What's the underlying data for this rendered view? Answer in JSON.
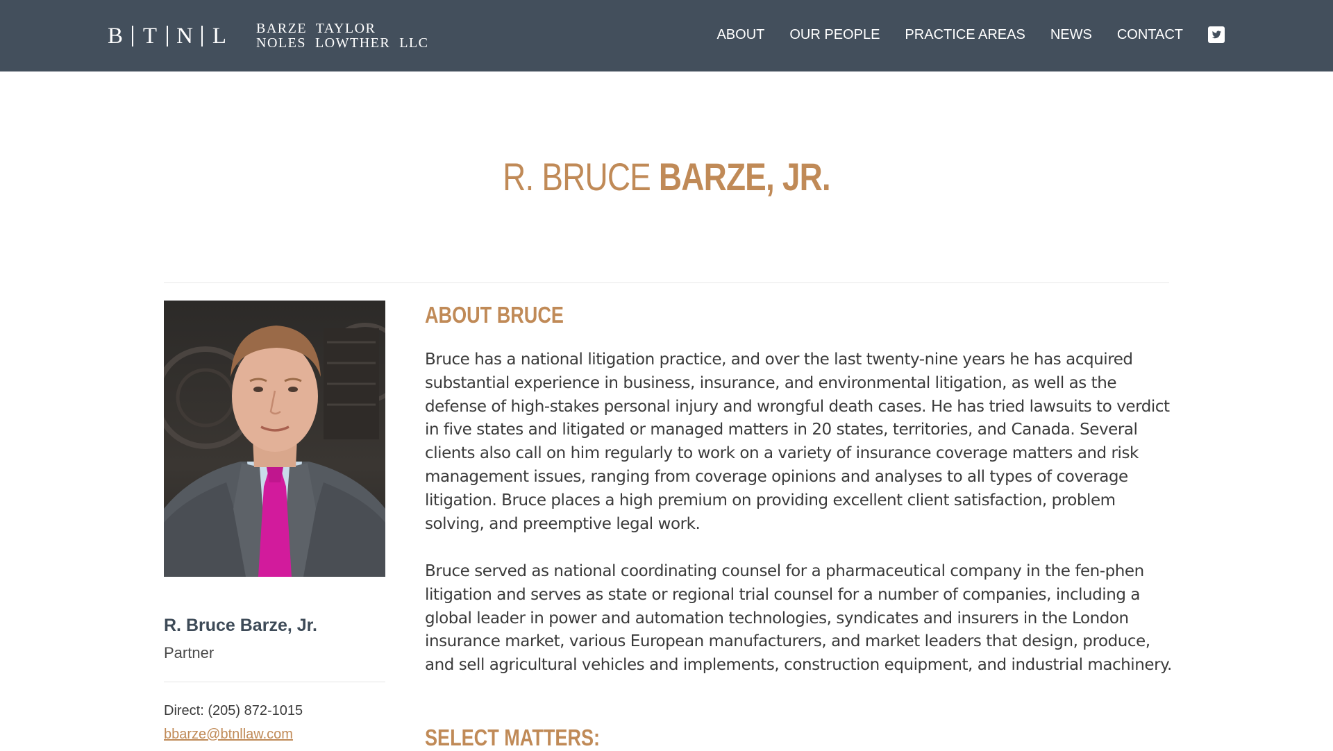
{
  "header": {
    "logo_letters": [
      "B",
      "T",
      "N",
      "L"
    ],
    "logo_name_line1": "BARZE  TAYLOR",
    "logo_name_line2": "NOLES  LOWTHER  LLC",
    "nav": [
      {
        "label": "ABOUT"
      },
      {
        "label": "OUR PEOPLE"
      },
      {
        "label": "PRACTICE AREAS"
      },
      {
        "label": "NEWS"
      },
      {
        "label": "CONTACT"
      }
    ],
    "social_icon": "twitter-icon",
    "background_color": "#434f5c"
  },
  "page": {
    "title_first": "R. BRUCE ",
    "title_last": "BARZE, JR.",
    "accent_color": "#c08a57"
  },
  "profile": {
    "photo_icon": "person-photo",
    "name": "R. Bruce Barze, Jr.",
    "role": "Partner",
    "direct": "Direct: (205) 872-1015",
    "email": "bbarze@btnllaw.com"
  },
  "about": {
    "heading": "ABOUT BRUCE",
    "paragraph1": "Bruce has a national litigation practice, and over the last twenty-nine years he has acquired substantial experience in business, insurance, and environmental litigation, as well as the defense of high-stakes personal injury and wrongful death cases. He has tried lawsuits to verdict in five states and litigated or managed matters in 20 states, territories, and Canada. Several clients also call on him regularly to work on a variety of insurance coverage matters and risk management issues, ranging from coverage opinions and analyses to all types of coverage litigation. Bruce places a high premium on providing excellent client satisfaction, problem solving, and preemptive legal work.",
    "paragraph2": "Bruce served as national coordinating counsel for a pharmaceutical company in the fen-phen litigation and serves as state or regional trial counsel for a number of companies, including a global leader in power and automation technologies, syndicates and insurers in the London insurance market, various European manufacturers, and market leaders that design, produce, and sell agricultural vehicles and implements, construction equipment, and industrial machinery."
  },
  "matters": {
    "heading": "SELECT MATTERS:"
  }
}
